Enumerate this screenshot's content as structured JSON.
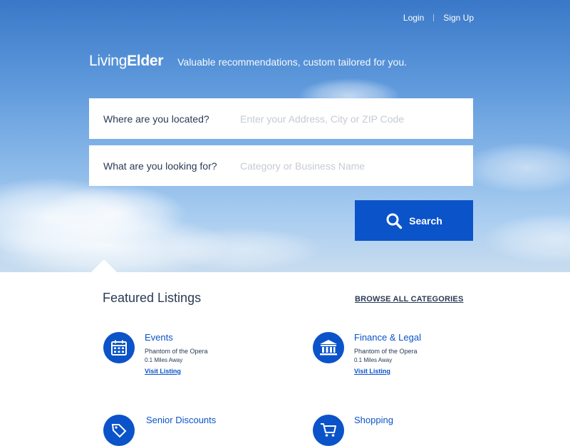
{
  "nav": {
    "login": "Login",
    "signup": "Sign Up"
  },
  "brand": {
    "logo_light": "Living",
    "logo_bold": "Elder",
    "tagline": "Valuable recommendations, custom tailored for you."
  },
  "search": {
    "location_label": "Where are you located?",
    "location_placeholder": "Enter your Address, City or ZIP Code",
    "query_label": "What are you looking for?",
    "query_placeholder": "Category or Business Name",
    "button_label": "Search"
  },
  "featured": {
    "title": "Featured Listings",
    "browse_label": "BROWSE ALL CATEGORIES",
    "listings": [
      {
        "name": "Events",
        "subtitle": "Phantom of the Opera",
        "distance": "0.1 Miles Away",
        "link": "Visit Listing",
        "icon": "calendar-icon"
      },
      {
        "name": "Finance & Legal",
        "subtitle": "Phantom of the Opera",
        "distance": "0.1 Miles Away",
        "link": "Visit Listing",
        "icon": "bank-icon"
      },
      {
        "name": "Senior Discounts",
        "icon": "tag-icon"
      },
      {
        "name": "Shopping",
        "icon": "cart-icon"
      }
    ]
  },
  "colors": {
    "primary": "#0b53c9",
    "text": "#2a3b55",
    "placeholder": "#c6cbd3"
  }
}
